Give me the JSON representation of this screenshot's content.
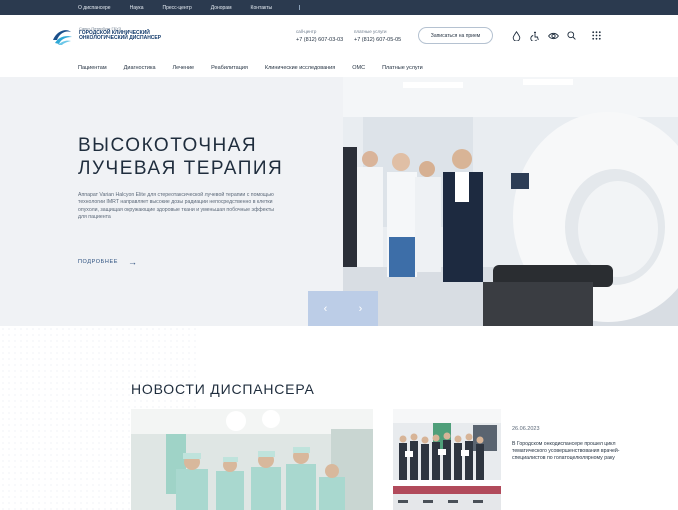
{
  "topbar": {
    "links": [
      "О диспансере",
      "Наука",
      "Пресс-центр",
      "Донорам",
      "Контакты"
    ]
  },
  "header": {
    "logo_small": "Санкт-Петербург ГБУЗ",
    "logo_line1": "Городской клинический",
    "logo_line2": "онкологический диспансер",
    "phone1_label": "call-центр",
    "phone1_number": "+7 (812) 607-03-03",
    "phone2_label": "платные услуги",
    "phone2_number": "+7 (812) 607-05-05",
    "appointment_button": "Записаться на прием",
    "icons": [
      "drop-icon",
      "accessibility-icon",
      "eye-icon",
      "search-icon",
      "grid-menu-icon"
    ]
  },
  "nav": {
    "items": [
      "Пациентам",
      "Диагностика",
      "Лечение",
      "Реабилитация",
      "Клинические исследования",
      "ОМС",
      "Платные услуги"
    ]
  },
  "hero": {
    "title_line1": "ВЫСОКОТОЧНАЯ",
    "title_line2": "ЛУЧЕВАЯ ТЕРАПИЯ",
    "description": "Аппарат Varian Halcyon Elite для стереотаксической лучевой терапии с помощью технологии IMRT направляет высокие дозы радиации непосредственно в клетки опухоли, защищая окружающие здоровые ткани и уменьшая побочные эффекты для пациента",
    "more_link": "ПОДРОБНЕЕ",
    "prev_arrow": "‹",
    "next_arrow": "›"
  },
  "news": {
    "section_title": "НОВОСТИ ДИСПАНСЕРА",
    "item_date": "26.06.2023",
    "item_text": "В Городском онкодиспансере прошел цикл тематического усовершенствования врачей-специалистов по голатоцелюлярному раку"
  },
  "colors": {
    "topbar_bg": "#2b3a4f",
    "hero_bg": "#f0f2f5",
    "accent": "#2b4f7e",
    "slider_bg": "#bccde7"
  }
}
